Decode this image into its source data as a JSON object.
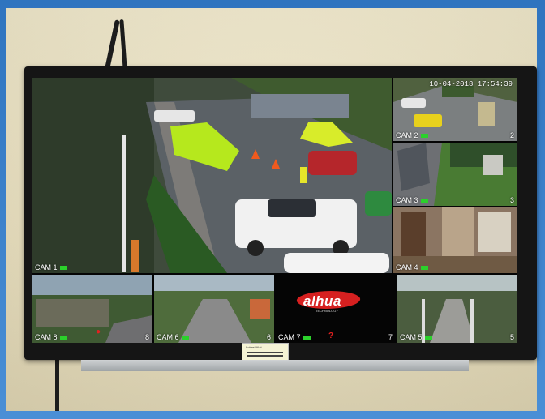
{
  "overlay": {
    "timestamp": "10-04-2018 17:54:39",
    "brand": "alhua",
    "brand_sub": "TECHNOLOGY",
    "sticker_text": "Lokasi/Alat"
  },
  "cameras": [
    {
      "label": "CAM 1",
      "num": ""
    },
    {
      "label": "CAM 2",
      "num": "2"
    },
    {
      "label": "CAM 3",
      "num": "3"
    },
    {
      "label": "CAM 4",
      "num": ""
    },
    {
      "label": "CAM 8",
      "num": "8"
    },
    {
      "label": "CAM 6",
      "num": "6"
    },
    {
      "label": "CAM 7",
      "num": "7"
    },
    {
      "label": "CAM 5",
      "num": "5"
    }
  ],
  "colors": {
    "record_indicator": "#2bd12b",
    "alert": "#e42020",
    "frame": "#3a7ec4"
  }
}
